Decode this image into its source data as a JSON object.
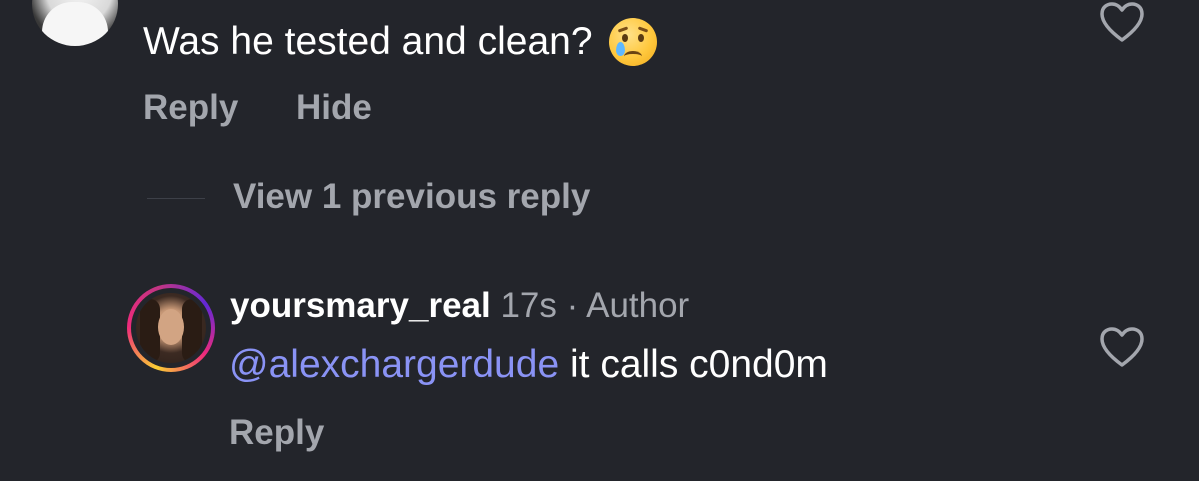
{
  "comments": [
    {
      "text": "Was he tested and clean?",
      "emoji": "crying-face",
      "actions": {
        "reply_label": "Reply",
        "hide_label": "Hide"
      },
      "like_icon": "heart-outline-icon"
    },
    {
      "username": "yoursmary_real",
      "time": "17s",
      "separator": "·",
      "badge": "Author",
      "mention": "@alexchargerdude",
      "text": "it calls c0nd0m",
      "actions": {
        "reply_label": "Reply"
      },
      "like_icon": "heart-outline-icon"
    }
  ],
  "replies_toggle": {
    "label": "View 1 previous reply"
  },
  "colors": {
    "background": "#23252b",
    "primary_text": "#ffffff",
    "secondary_text": "#a3a6ad",
    "mention": "#8a93f5"
  }
}
